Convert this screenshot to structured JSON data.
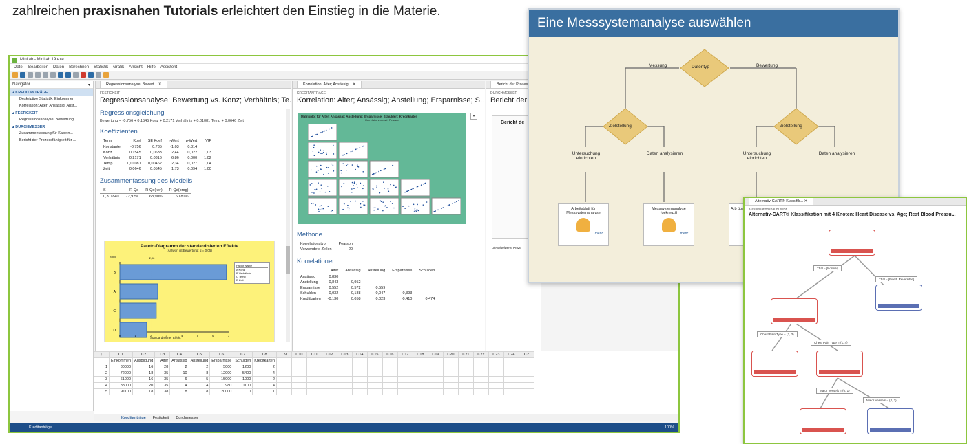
{
  "intro": {
    "before": "zahlreichen ",
    "bold": "praxisnahen Tutorials",
    "after": " erleichtert den Einstieg in die Materie."
  },
  "minitab": {
    "window_title": "Minitab - Minitab 19.exe",
    "menu": [
      "Datei",
      "Bearbeiten",
      "Daten",
      "Berechnen",
      "Statistik",
      "Grafik",
      "Ansicht",
      "Hilfe",
      "Assistent"
    ],
    "navigator_label": "Navigator",
    "nav": [
      {
        "section": "KREDITANTRÄGE",
        "items": [
          "Deskriptive Statistik: Einkommen",
          "Korrelation: Alter; Ansässig; Anst..."
        ]
      },
      {
        "section": "FESTIGKEIT",
        "items": [
          "Regressionsanalyse: Bewertung ..."
        ]
      },
      {
        "section": "DURCHMESSER",
        "items": [
          "Zusammenfassung für Kabeln...",
          "Bericht der Prozessfähigkeit für ..."
        ]
      }
    ],
    "pane1": {
      "tab": "Regressionsanalyse: Bewert...",
      "category": "FESTIGKEIT",
      "title": "Regressionsanalyse: Bewertung vs. Konz; Verhältnis; Te...",
      "eq_head": "Regressionsgleichung",
      "equation": "Bewertung  =  -0,756 + 0,1545 Konz + 0,2171 Verhältnis + 0,01081 Temp + 0,0646 Zeit",
      "coef_head": "Koeffizienten",
      "coef_cols": [
        "Term",
        "Koef",
        "SE Koef",
        "t-Wert",
        "p-Wert",
        "VIF"
      ],
      "coef_rows": [
        [
          "Konstante",
          "-0,756",
          "0,735",
          "-1,03",
          "0,314",
          ""
        ],
        [
          "Konz",
          "0,1545",
          "0,0633",
          "2,44",
          "0,022",
          "1,03"
        ],
        [
          "Verhältnis",
          "0,2171",
          "0,0316",
          "6,86",
          "0,000",
          "1,02"
        ],
        [
          "Temp",
          "0,01081",
          "0,00462",
          "2,34",
          "0,027",
          "1,04"
        ],
        [
          "Zeit",
          "0,0646",
          "0,0545",
          "1,73",
          "0,094",
          "1,00"
        ]
      ],
      "model_head": "Zusammenfassung des Modells",
      "model_cols": [
        "S",
        "R-Qd",
        "R-Qd(kor)",
        "R-Qd(prog)"
      ],
      "model_row": [
        "0,311840",
        "72,92%",
        "68,90%",
        "60,81%"
      ],
      "pareto_title": "Pareto-Diagramm der standardisierten Effekte",
      "pareto_sub": "(Antwort ist Bewertung; α = 0,05)",
      "pareto_term": "Term",
      "pareto_xlabel": "Standardisierter Effekt",
      "pareto_ref": "2,06",
      "pareto_legend_head": [
        "Faktor",
        "Name"
      ],
      "pareto_legend": [
        [
          "A",
          "Konz"
        ],
        [
          "B",
          "Verhältnis"
        ],
        [
          "C",
          "Temp"
        ],
        [
          "D",
          "Zeit"
        ]
      ]
    },
    "pareto_data": {
      "type": "bar",
      "categories": [
        "B",
        "A",
        "C",
        "D"
      ],
      "values": [
        6.86,
        2.44,
        2.34,
        1.73
      ],
      "xlim": [
        0,
        7
      ]
    },
    "pane2": {
      "tab": "Korrelation: Alter; Ansässig...",
      "category": "KREDITANTRÄGE",
      "title": "Korrelation: Alter; Ansässig; Anstellung; Ersparnisse; S...",
      "matrix_title": "Matrixplot für Alter; Ansässig; Anstellung; Ersparnisse; Schulden; Kreditkarten",
      "matrix_sub": "Korrelationen nach Pearson",
      "method_head": "Methode",
      "method": [
        [
          "Korrelationstyp",
          "Pearson"
        ],
        [
          "Verwendete Zeilen",
          "20"
        ]
      ],
      "corr_head": "Korrelationen",
      "corr_cols": [
        "",
        "Alter",
        "Ansässig",
        "Anstellung",
        "Ersparnisse",
        "Schulden"
      ],
      "corr_rows": [
        [
          "Ansässig",
          "0,830",
          "",
          "",
          "",
          ""
        ],
        [
          "Anstellung",
          "0,843",
          "0,952",
          "",
          "",
          ""
        ],
        [
          "Ersparnisse",
          "0,552",
          "0,572",
          "0,559",
          "",
          ""
        ],
        [
          "Schulden",
          "0,032",
          "0,188",
          "0,047",
          "-0,393",
          ""
        ],
        [
          "Kreditkarten",
          "-0,130",
          "0,058",
          "0,023",
          "-0,410",
          "0,474"
        ]
      ]
    },
    "pane3": {
      "tab": "Bericht der Prozess...",
      "category": "DURCHMESSER",
      "title": "Bericht der P",
      "inner": "Bericht de",
      "footer": "Die Mittelwerte Proze"
    },
    "worksheet": {
      "cols": [
        "C1",
        "C2",
        "C3",
        "C4",
        "C5",
        "C6",
        "C7",
        "C8",
        "C9",
        "C10",
        "C11",
        "C12",
        "C13",
        "C14",
        "C15",
        "C16",
        "C17",
        "C18",
        "C19",
        "C20",
        "C21",
        "C22",
        "C23",
        "C24",
        "C2"
      ],
      "names": [
        "Einkommen",
        "Ausbildung",
        "Alter",
        "Ansässig",
        "Anstellung",
        "Ersparnisse",
        "Schulden",
        "Kreditkarten"
      ],
      "rows": [
        [
          "1",
          "30000",
          "16",
          "28",
          "2",
          "2",
          "5000",
          "1200",
          "2"
        ],
        [
          "2",
          "72000",
          "18",
          "35",
          "10",
          "8",
          "12000",
          "5400",
          "4"
        ],
        [
          "3",
          "61000",
          "16",
          "35",
          "6",
          "5",
          "15000",
          "1000",
          "2"
        ],
        [
          "4",
          "88000",
          "20",
          "35",
          "4",
          "4",
          "980",
          "1100",
          "4"
        ],
        [
          "5",
          "91100",
          "18",
          "38",
          "8",
          "8",
          "20000",
          "0",
          "1"
        ]
      ],
      "sheets": [
        "Kreditanträge",
        "Festigkeit",
        "Durchmesser"
      ]
    },
    "status_text": "Kreditanträge",
    "zoom": "100%"
  },
  "overlay1": {
    "title": "Eine Messsystemanalyse auswählen",
    "root": "Datentyp",
    "left_branch": "Messung",
    "right_branch": "Bewertung",
    "decision": "Zielstellung",
    "opt1": "Untersuchung einrichten",
    "opt2": "Daten analysieren",
    "card1": "Arbeitsblatt für Messsystemanalyse",
    "card2": "Messsystemanalyse (gekreuzt)",
    "card3": "Arb über",
    "more": "mehr..."
  },
  "overlay2": {
    "tab": "Alternativ-CART® Klassifik...",
    "sub": "Klassifikationsbaum sehr",
    "title": "Alternativ-CART® Klassifikation mit 4 Knoten: Heart Disease vs. Age; Rest Blood Pressu...",
    "split1_left": "Thal = [Normal]",
    "split1_right": "Thal = [Fixed, Reversible]",
    "split2_left": "Chest Pain Type = {2, 3}",
    "split2_right": "Chest Pain Type = {1, 4}",
    "split3_left": "Major Vessels = {0, 1}",
    "split3_right": "Major Vessels = {2, 3}"
  }
}
